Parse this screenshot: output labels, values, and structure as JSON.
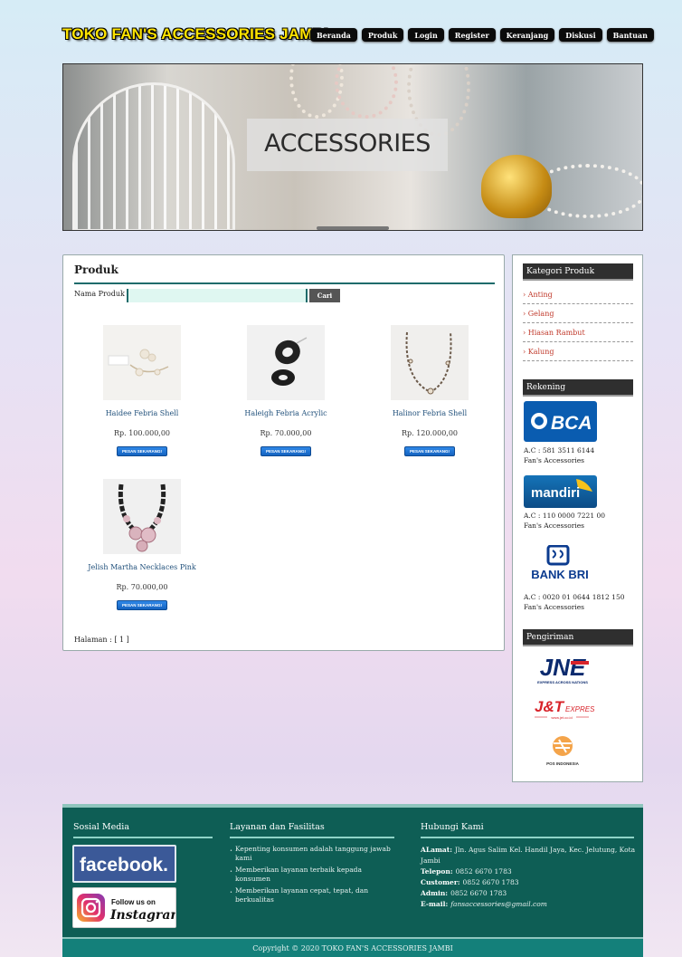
{
  "header": {
    "site_title": "TOKO FAN'S ACCESSORIES JAMBI",
    "nav": [
      "Beranda",
      "Produk",
      "Login",
      "Register",
      "Keranjang",
      "Diskusi",
      "Bantuan"
    ]
  },
  "banner": {
    "label": "ACCESSORIES"
  },
  "products_section": {
    "title": "Produk",
    "search_label": "Nama Produk :",
    "search_value": "",
    "search_button": "Cari",
    "items": [
      {
        "name": "Haidee Febria Shell",
        "price": "Rp. 100.000,00",
        "button": "PESAN SEKARANG!"
      },
      {
        "name": "Haleigh Febria Acrylic",
        "price": "Rp. 70.000,00",
        "button": "PESAN SEKARANG!"
      },
      {
        "name": "Halinor Febria Shell",
        "price": "Rp. 120.000,00",
        "button": "PESAN SEKARANG!"
      },
      {
        "name": "Jelish Martha Necklaces Pink",
        "price": "Rp. 70.000,00",
        "button": "PESAN SEKARANG!"
      }
    ],
    "pagination": "Halaman : [ 1 ]"
  },
  "sidebar": {
    "categories_title": "Kategori Produk",
    "categories": [
      "› Anting",
      "› Gelang",
      "› Hiasan Rambut",
      "› Kalung"
    ],
    "rekening_title": "Rekening",
    "banks": [
      {
        "logo_text": "BCA",
        "account": "A.C : 581 3511 6144",
        "holder": "Fan's Accessories",
        "color": "#0a5cb0"
      },
      {
        "logo_text": "mandiri",
        "account": "A.C : 110 0000 7221 00",
        "holder": "Fan's Accessories",
        "color": "#0e5a9e"
      },
      {
        "logo_text": "BANK BRI",
        "account": "A.C : 0020 01 0644 1812 150",
        "holder": "Fan's Accessories",
        "color": "#0b3b8f"
      }
    ],
    "pengiriman_title": "Pengiriman",
    "couriers": [
      {
        "logo_text": "JNE",
        "tagline": "EXPRESS ACROSS NATIONS"
      },
      {
        "logo_text": "J&T",
        "tagline": "EXPRESS",
        "sub": "www.jet.co.id"
      },
      {
        "logo_text": "POS INDONESIA"
      }
    ]
  },
  "footer": {
    "social_title": "Sosial Media",
    "facebook_label": "facebook.",
    "instagram_label_1": "Follow us on",
    "instagram_label_2": "Instagram",
    "services_title": "Layanan dan Fasilitas",
    "services": [
      "Kepenting konsumen adalah tanggung jawab kami",
      "Memberikan layanan terbaik kepada konsumen",
      "Memberikan layanan cepat, tepat, dan berkualitas"
    ],
    "contact_title": "Hubungi Kami",
    "contact": {
      "alamat_label": "ALamat:",
      "alamat": "Jln. Agus Salim Kel. Handil Jaya, Kec. Jelutung, Kota Jambi",
      "telepon_label": "Telepon:",
      "telepon": "0852 6670 1783",
      "customer_label": "Customer:",
      "customer": "0852 6670 1783",
      "admin_label": "Admin:",
      "admin": "0852 6670 1783",
      "email_label": "E-mail:",
      "email": "fansaccessories@gmail.com"
    },
    "copyright": "Copyright © 2020 TOKO FAN'S ACCESSORIES JAMBI"
  },
  "colors": {
    "accent": "#1f6b6b",
    "footer": "#0e5e55",
    "title": "#ffe400"
  }
}
